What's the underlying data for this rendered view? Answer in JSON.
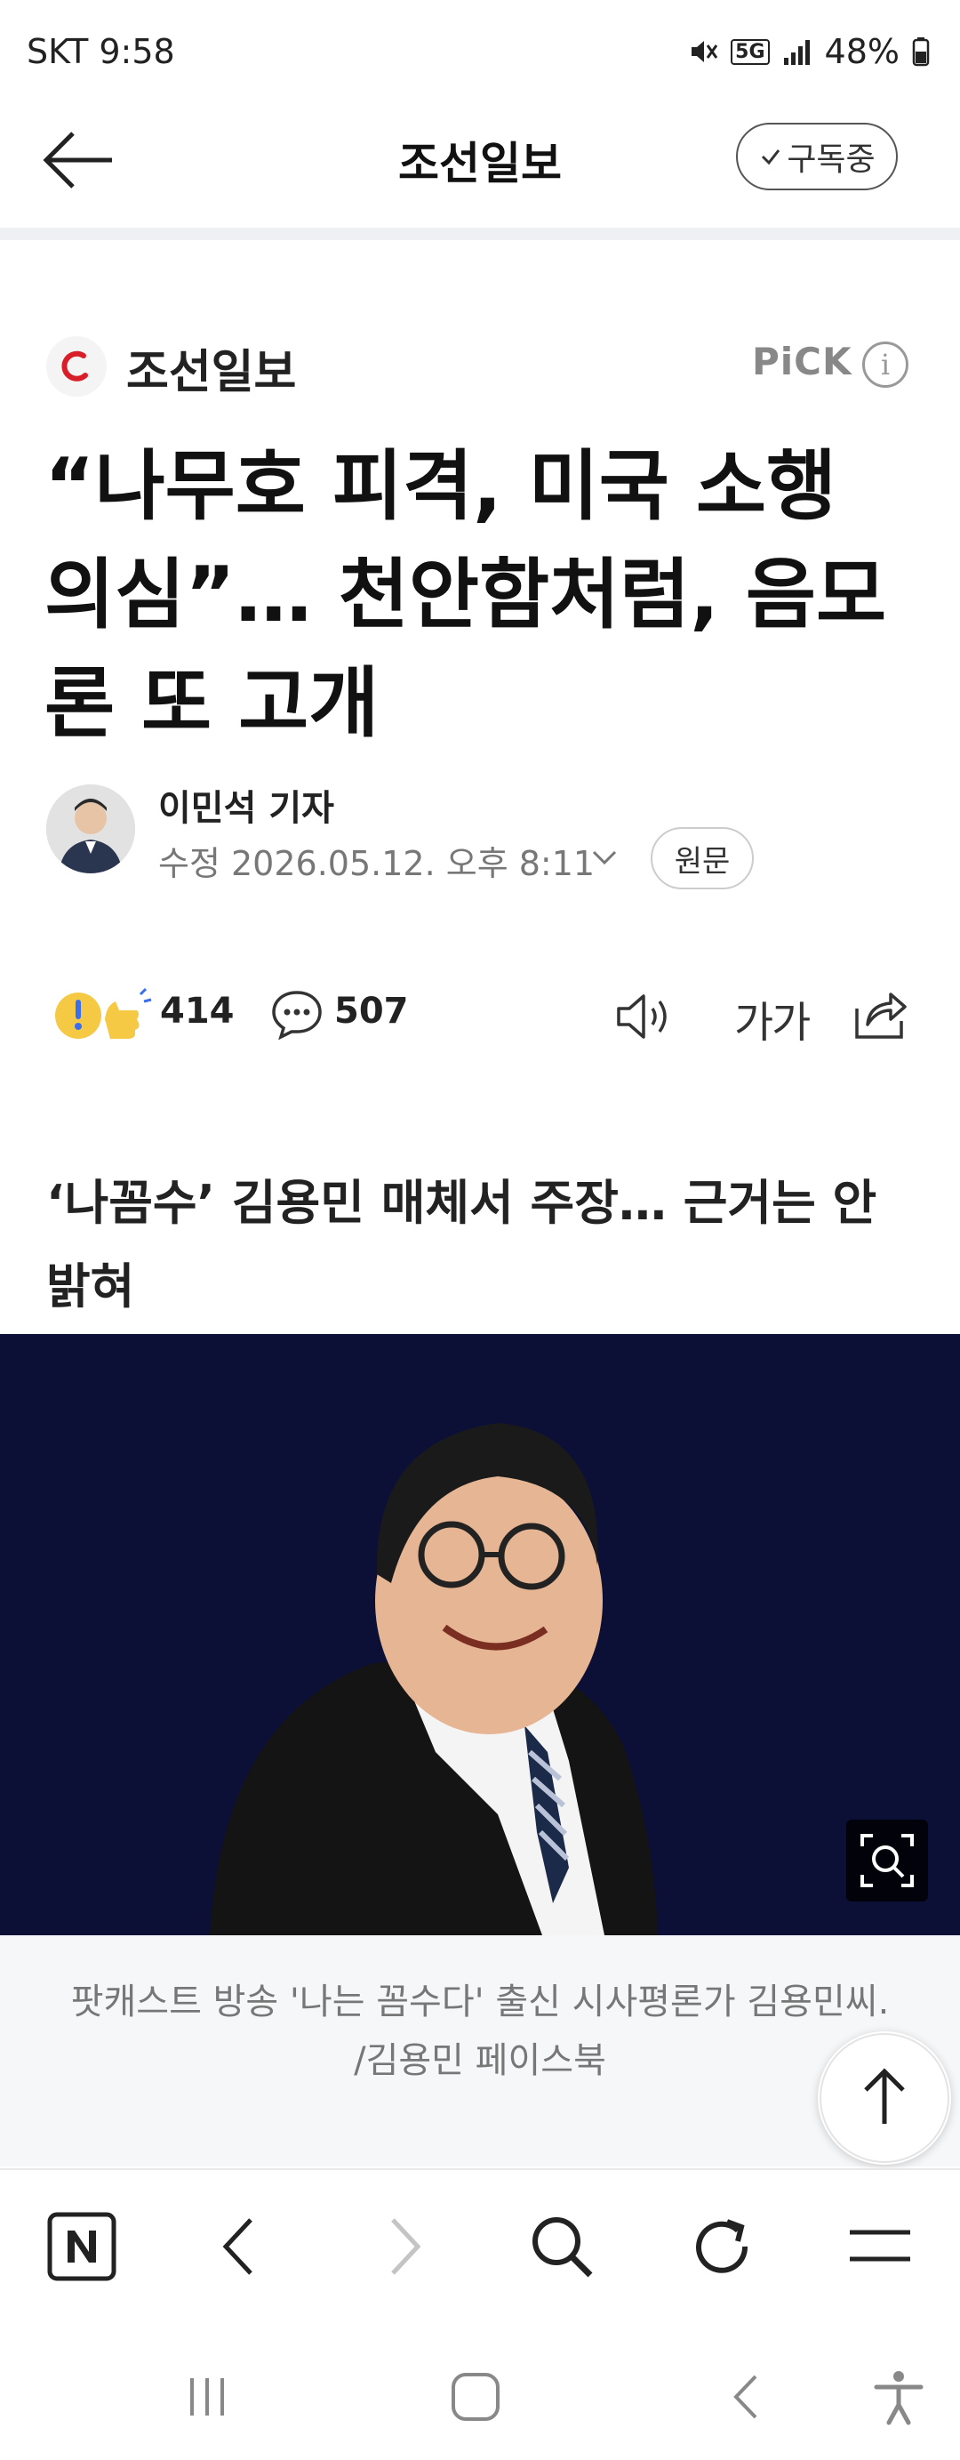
{
  "status_bar": {
    "carrier": "SKT 9:58",
    "network": "5G",
    "battery": "48%"
  },
  "header": {
    "title": "조선일보",
    "subscribe_label": "구독중"
  },
  "article": {
    "press_name": "조선일보",
    "pick_label": "PiCK",
    "headline": "“나무호 피격, 미국 소행 의심”… 천안함처럼, 음모론 또 고개",
    "author": "이민석 기자",
    "edit_time": "수정 2026.05.12. 오후 8:11",
    "source_label": "원문",
    "reaction_count": "414",
    "comment_count": "507",
    "font_size_label": "가가",
    "subheadline": "‘나꼼수’ 김용민 매체서 주장… 근거는 안 밝혀",
    "caption": "팟캐스트 방송 '나는 꼼수다' 출신 시사평론가 김용민씨. /김용민 페이스북"
  },
  "icons": {
    "back": "arrow-left-icon",
    "info": "info-icon",
    "comment": "speech-bubble-icon",
    "audio": "speaker-icon",
    "share": "share-icon",
    "zoom": "zoom-icon",
    "scroll_top": "arrow-up-icon"
  },
  "bottom_nav": [
    "naver-home",
    "back",
    "forward",
    "search",
    "refresh",
    "menu"
  ],
  "colors": {
    "accent_red": "#d81e28",
    "photo_bg": "#0d1036"
  }
}
